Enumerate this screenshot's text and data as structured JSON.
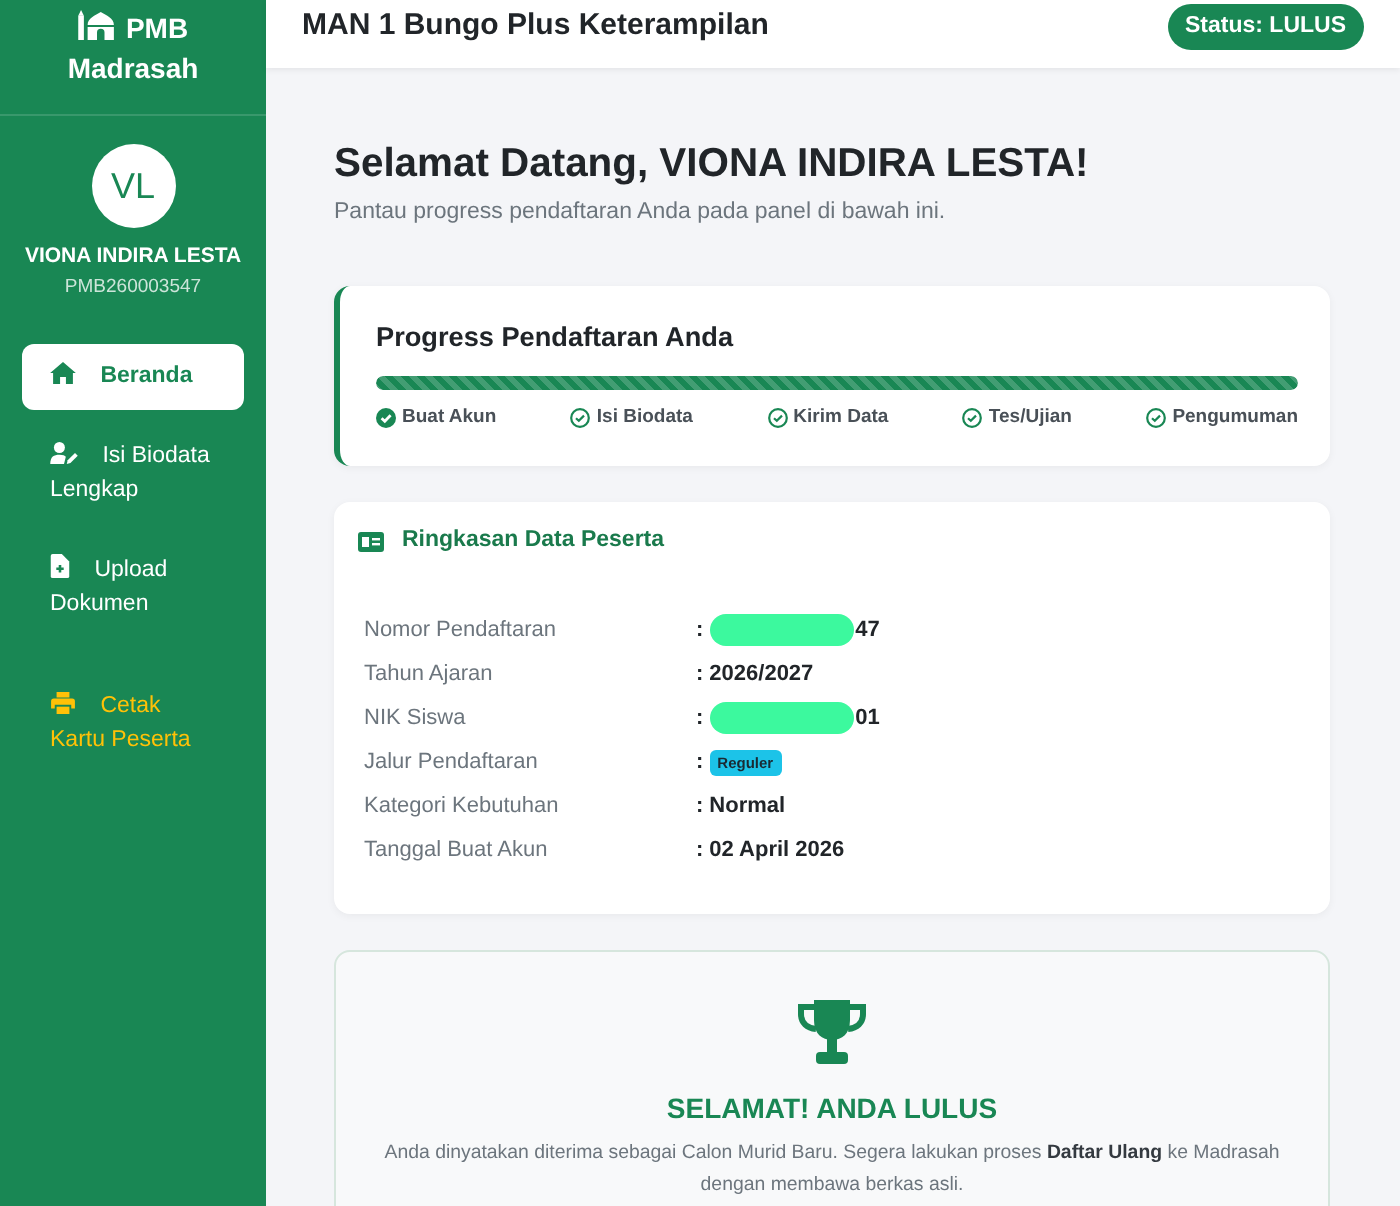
{
  "sidebar": {
    "brand": [
      "PMB",
      "Madrasah"
    ],
    "avatar_initials": "VL",
    "user_name": "VIONA INDIRA LESTA",
    "user_id": "PMB260003547",
    "items": [
      {
        "label": "Beranda",
        "selected": true,
        "accent": false
      },
      {
        "label": "Isi Biodata Lengkap",
        "selected": false,
        "accent": false
      },
      {
        "label": "Upload Dokumen",
        "selected": false,
        "accent": false
      },
      {
        "label": "Cetak Kartu Peserta",
        "selected": false,
        "accent": true
      }
    ]
  },
  "header": {
    "title": "MAN 1 Bungo Plus Keterampilan",
    "status": "Status: LULUS"
  },
  "welcome": {
    "title": "Selamat Datang, VIONA INDIRA LESTA!",
    "subtitle": "Pantau progress pendaftaran Anda pada panel di bawah ini."
  },
  "progress": {
    "title": "Progress Pendaftaran Anda",
    "level": 1,
    "steps": [
      {
        "label": "Buat Akun",
        "current": true
      },
      {
        "label": "Isi Biodata",
        "current": false
      },
      {
        "label": "Kirim Data",
        "current": false
      },
      {
        "label": "Tes/Ujian",
        "current": false
      },
      {
        "label": "Pengumuman",
        "current": false
      }
    ]
  },
  "summary": {
    "title": "Ringkasan Data Peserta",
    "rows": [
      {
        "label": "Nomor Pendaftaran",
        "colon": ":",
        "kind": "redacted",
        "value": "47"
      },
      {
        "label": "Tahun Ajaran",
        "colon": ":",
        "kind": "text",
        "value": "2026/2027"
      },
      {
        "label": "NIK Siswa",
        "colon": ":",
        "kind": "redacted",
        "value": "01"
      },
      {
        "label": "Jalur Pendaftaran",
        "colon": ":",
        "kind": "badge",
        "value": "Reguler"
      },
      {
        "label": "Kategori Kebutuhan",
        "colon": ":",
        "kind": "text",
        "value": "Normal"
      },
      {
        "label": "Tanggal Buat Akun",
        "colon": ":",
        "kind": "text",
        "value": "02 April 2026"
      }
    ]
  },
  "result": {
    "title": "SELAMAT! ANDA LULUS",
    "message": "Anda dinyatakan diterima sebagai Calon Murid Baru. Segera lakukan proses **Daftar Ulang** ke Madrasah dengan membawa berkas asli."
  }
}
